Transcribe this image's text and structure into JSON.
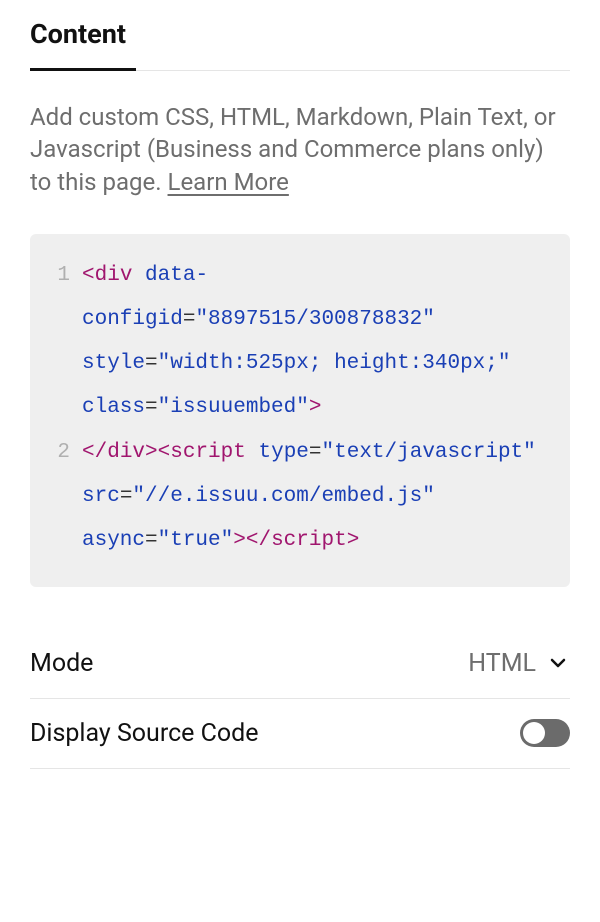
{
  "tabs": {
    "content_label": "Content"
  },
  "description": {
    "text": "Add custom CSS, HTML, Markdown, Plain Text, or Javascript (Business and Commerce plans only) to this page. ",
    "learn_more_label": "Learn More"
  },
  "code": {
    "line1_no": "1",
    "line2_no": "2",
    "tokens": {
      "open_angle1": "<",
      "div_tag": "div",
      "space": " ",
      "data_dash": "data-",
      "configid_attr": "configid",
      "eq": "=",
      "configid_val": "\"8897515/300878832\"",
      "style_attr": "style",
      "style_val1": "\"width:525px;",
      "style_val2": "height:340px;\"",
      "class_attr": "class",
      "class_val": "\"issuuembed\"",
      "close_angle1": ">",
      "endtag_open": "</",
      "endtag_div": "div",
      "endtag_close": ">",
      "script_open_angle": "<",
      "script_tag": "script",
      "type_attr": "type",
      "type_val": "\"text/javascript\"",
      "src_attr": "src",
      "src_val": "\"//e.issuu.com/embed.js\"",
      "async_attr": "async",
      "async_val": "\"true\"",
      "script_close1": ">",
      "end_script_open": "</",
      "end_script_tag": "script",
      "end_script_close": ">"
    }
  },
  "settings": {
    "mode_label": "Mode",
    "mode_value": "HTML",
    "display_source_label": "Display Source Code",
    "display_source_on": false
  }
}
